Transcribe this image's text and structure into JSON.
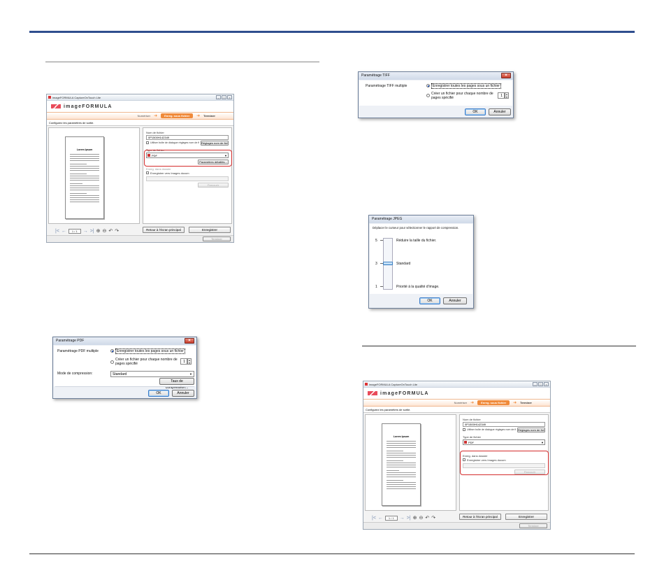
{
  "app": {
    "title": "imageFORMULA CaptureOnTouch Lite",
    "brand": "imageFORMULA",
    "steps": {
      "scan": "Numériser",
      "save": "Enreg. sous fichier",
      "finish": "Terminer"
    },
    "instruction": "Configurez les paramètres de sortie.",
    "page_indicator": "1 / 1",
    "sample_title": "Lorem Ipsum",
    "file_name_label": "Nom de fichier",
    "file_name_value": "0P1500H142349",
    "use_settings_label": "Utiliser boîte de dialogue réglages nom de fichier",
    "file_name_settings_btn": "Réglages nom de fichier",
    "file_type_label": "Type de fichier",
    "file_type_value": "PDF",
    "detail_settings_btn": "Paramètres détaillés...",
    "save_folder_label": "Enreg. dans dossier",
    "save_in_folder_label": "Enregistrer vers Images docum",
    "browse_btn": "Parcourir",
    "return_btn": "Retour à l'écran principal",
    "save_btn": "Enregistrer",
    "exit_btn": "Terminer",
    "win_buttons": [
      "–",
      "□",
      "×"
    ]
  },
  "tiff_dialog": {
    "title": "Paramétrage TIFF",
    "multi_label": "Paramétrage TIFF multiple",
    "opt1": "Enregistrer toutes les pages sous un fichier",
    "opt2_l1": "Créer un fichier pour chaque nombre de",
    "opt2_l2": "pages spécifié",
    "spin_value": "1",
    "ok": "OK",
    "cancel": "Annuler"
  },
  "jpeg_dialog": {
    "title": "Paramétrage JPEG",
    "instruction": "Déplacer le curseur pour sélectionner le rapport de compression.",
    "levels": [
      {
        "num": "5",
        "text": "Réduire la taille du fichier."
      },
      {
        "num": "3",
        "text": "Standard"
      },
      {
        "num": "1",
        "text": "Priorité à la qualité d'image."
      }
    ],
    "slider_level": 3,
    "ok": "OK",
    "cancel": "Annuler"
  },
  "pdf_dialog": {
    "title": "Paramétrage PDF",
    "multi_label": "Paramétrage PDF multiple",
    "opt1": "Enregistrer toutes les pages sous un fichier",
    "opt2_l1": "Créer un fichier pour chaque nombre de",
    "opt2_l2": "pages spécifié",
    "spin_value": "1",
    "compression_label": "Mode de compression:",
    "compression_value": "Standard",
    "compression_rate_btn": "Taux de compression...",
    "ok": "OK",
    "cancel": "Annuler"
  }
}
